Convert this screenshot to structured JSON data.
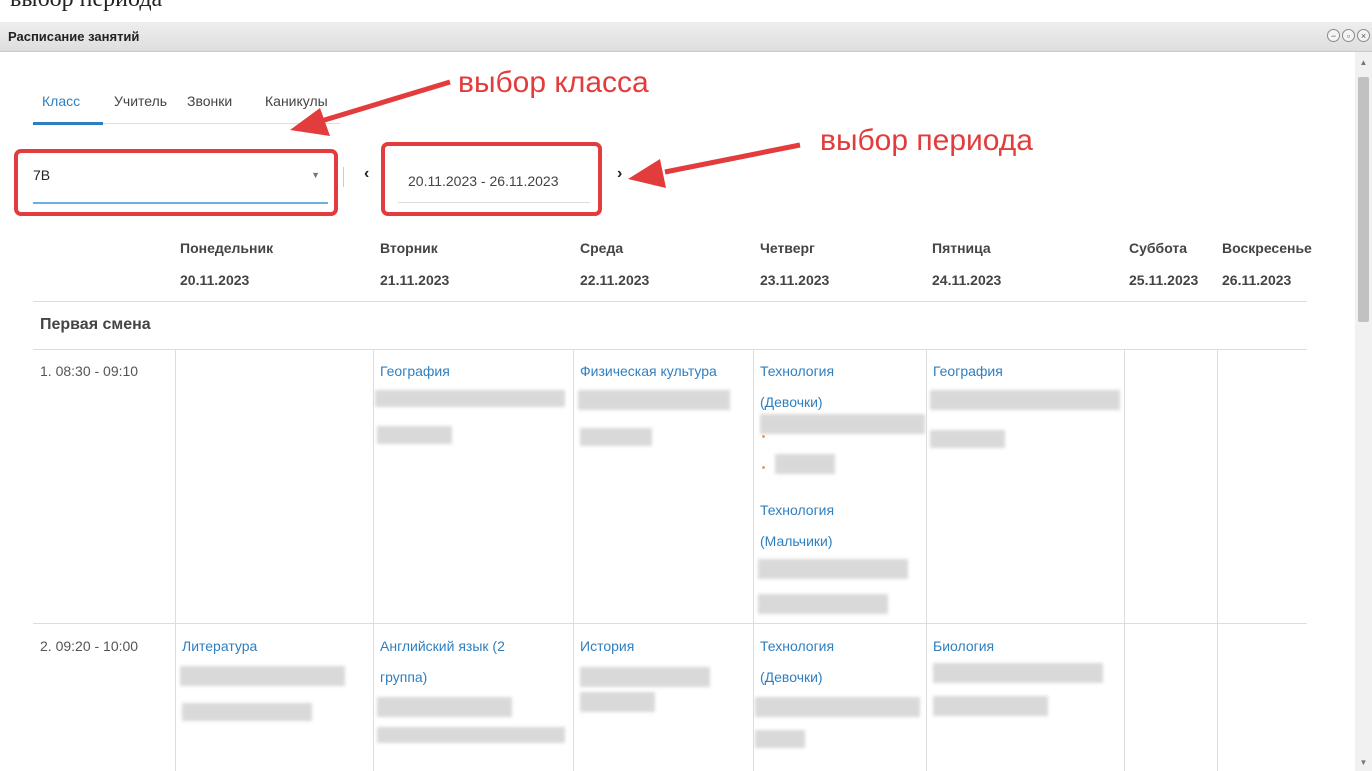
{
  "doc_top_text": "выбор периода",
  "window": {
    "title": "Расписание занятий"
  },
  "tabs": [
    "Класс",
    "Учитель",
    "Звонки",
    "Каникулы"
  ],
  "class_select": {
    "value": "7В"
  },
  "period": {
    "value": "20.11.2023 - 26.11.2023"
  },
  "annotations": {
    "class_label": "выбор класса",
    "period_label": "выбор периода",
    "color": "#e23c3c"
  },
  "days": [
    {
      "name": "Понедельник",
      "date": "20.11.2023"
    },
    {
      "name": "Вторник",
      "date": "21.11.2023"
    },
    {
      "name": "Среда",
      "date": "22.11.2023"
    },
    {
      "name": "Четверг",
      "date": "23.11.2023"
    },
    {
      "name": "Пятница",
      "date": "24.11.2023"
    },
    {
      "name": "Суббота",
      "date": "25.11.2023"
    },
    {
      "name": "Воскресенье",
      "date": "26.11.2023"
    }
  ],
  "shift": "Первая смена",
  "lessons": [
    {
      "time": "1. 08:30 - 09:10",
      "tue": "География",
      "wed": "Физическая культура",
      "thu_1a": "Технология",
      "thu_1b": "(Девочки)",
      "thu_2a": "Технология",
      "thu_2b": "(Мальчики)",
      "fri": "География"
    },
    {
      "time": "2. 09:20 - 10:00",
      "mon": "Литература",
      "tue_a": "Английский язык (2",
      "tue_b": "группа)",
      "wed": "История",
      "thu_a": "Технология",
      "thu_b": "(Девочки)",
      "fri": "Биология"
    }
  ],
  "colors": {
    "accent": "#2f7fbf",
    "annotation": "#e23c3c"
  }
}
